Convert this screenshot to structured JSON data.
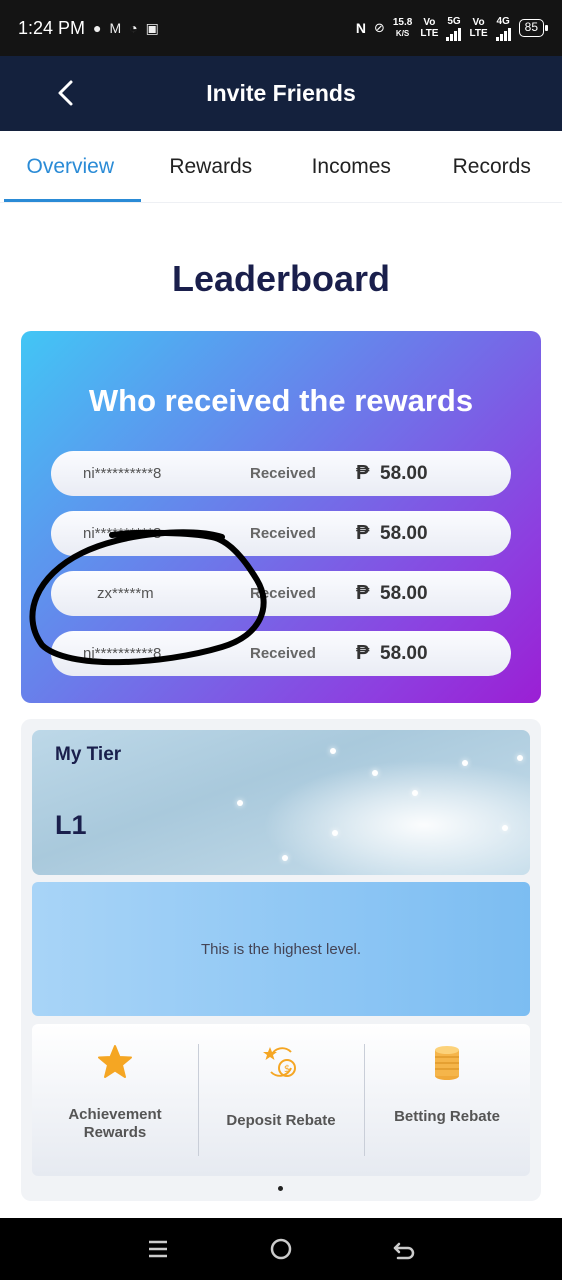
{
  "status_bar": {
    "time": "1:24 PM",
    "speed": "15.8",
    "speed_unit": "K/S",
    "net1_top": "Vo",
    "net1_bottom": "LTE",
    "net2": "5G",
    "net3_top": "Vo",
    "net3_bottom": "LTE",
    "net4": "4G",
    "battery": "85"
  },
  "header": {
    "title": "Invite Friends",
    "back_icon": "chevron-left-icon"
  },
  "tabs": [
    {
      "label": "Overview",
      "active": true
    },
    {
      "label": "Rewards",
      "active": false
    },
    {
      "label": "Incomes",
      "active": false
    },
    {
      "label": "Records",
      "active": false
    }
  ],
  "leaderboard": {
    "title": "Leaderboard",
    "card_heading": "Who received the rewards",
    "currency": "₱",
    "rows": [
      {
        "name": "ni**********8",
        "status": "Received",
        "amount": "58.00"
      },
      {
        "name": "ni**********8",
        "status": "Received",
        "amount": "58.00"
      },
      {
        "name": "zx*****m",
        "status": "Received",
        "amount": "58.00"
      },
      {
        "name": "ni**********8",
        "status": "Received",
        "amount": "58.00"
      }
    ]
  },
  "tier": {
    "label": "My Tier",
    "level": "L1",
    "message": "This is the highest level."
  },
  "benefits": [
    {
      "label": "Achievement Rewards",
      "icon": "star-icon"
    },
    {
      "label": "Deposit Rebate",
      "icon": "deposit-rebate-icon"
    },
    {
      "label": "Betting Rebate",
      "icon": "coin-stack-icon"
    }
  ],
  "colors": {
    "header_bg": "#14213d",
    "tab_active": "#2a8bd6",
    "title_text": "#1a1f4c",
    "icon_orange": "#f5a623"
  },
  "navigation": [
    "menu-icon",
    "home-icon",
    "back-icon"
  ]
}
